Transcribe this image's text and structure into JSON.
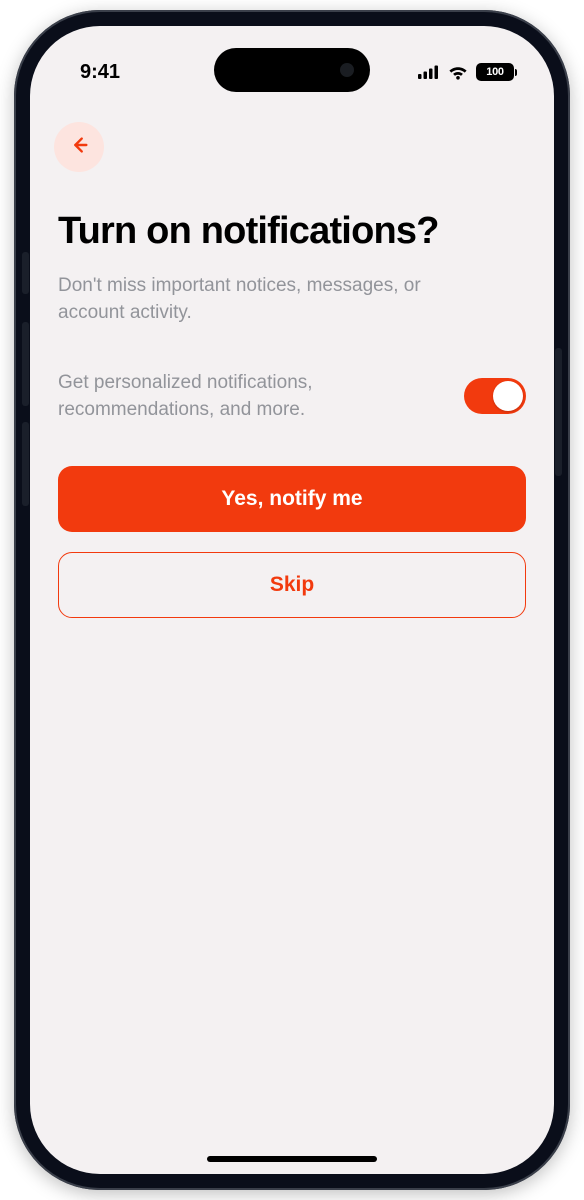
{
  "status": {
    "time": "9:41",
    "battery": "100"
  },
  "nav": {
    "back_icon": "arrow-left"
  },
  "page": {
    "title": "Turn on notifications?",
    "subtitle": "Don't miss important notices, messages, or account activity.",
    "toggle_label": "Get personalized notifications, recommendations, and more.",
    "toggle_on": true
  },
  "buttons": {
    "primary": "Yes, notify me",
    "secondary": "Skip"
  },
  "colors": {
    "accent": "#f23a0e",
    "bg": "#f4f1f2",
    "muted": "#92949a"
  }
}
